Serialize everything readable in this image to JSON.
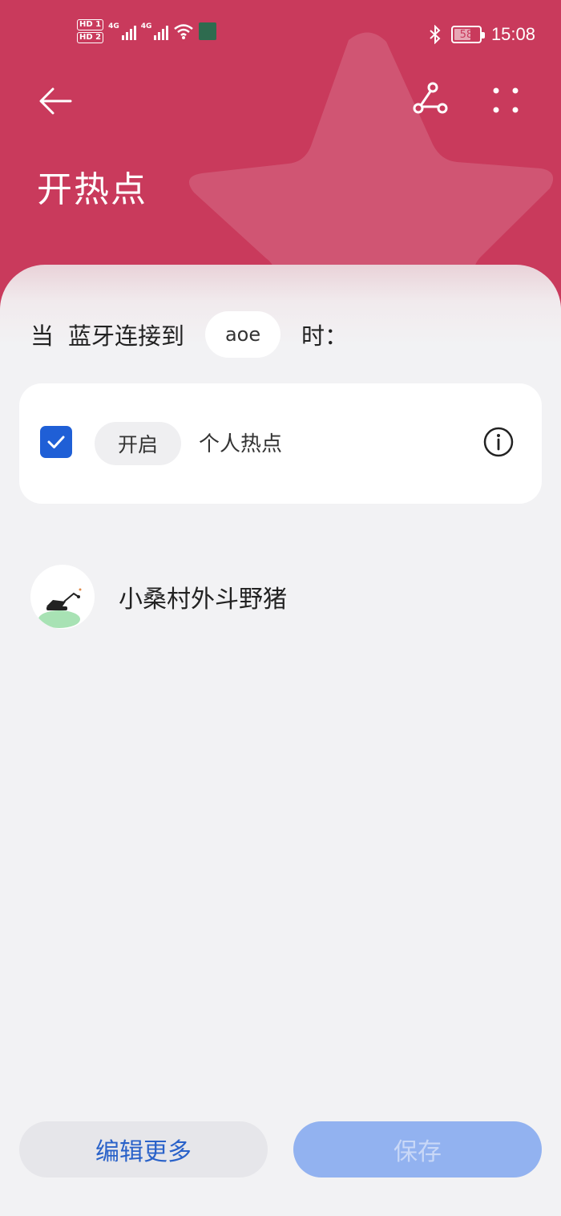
{
  "status_bar": {
    "hd1": "HD 1",
    "hd2": "HD 2",
    "net1": "4G",
    "net2": "4G",
    "battery": "58",
    "time": "15:08"
  },
  "header": {
    "title": "开热点",
    "accent_color": "#c93a5c"
  },
  "condition": {
    "when": "当",
    "trigger": "蓝牙连接到",
    "device": "aoe",
    "suffix": "时："
  },
  "action": {
    "checked": true,
    "verb": "开启",
    "target": "个人热点"
  },
  "author": {
    "name": "小桑村外斗野猪"
  },
  "buttons": {
    "edit_more": "编辑更多",
    "save": "保存"
  }
}
